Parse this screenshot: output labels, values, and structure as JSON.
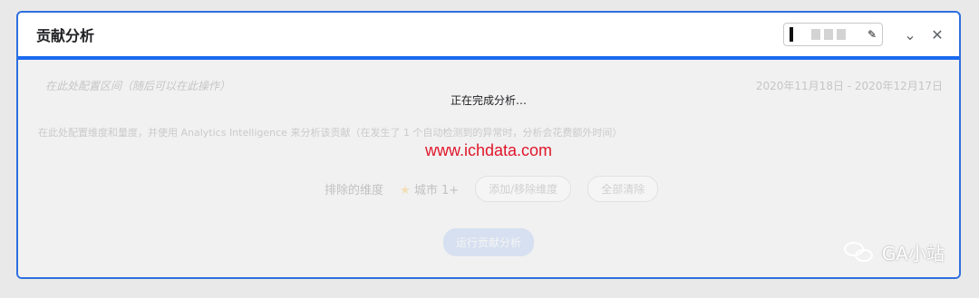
{
  "card": {
    "title": "贡献分析",
    "chip_edit_icon": "pencil-icon",
    "expand_icon": "chevron-down-icon",
    "close_icon": "close-icon"
  },
  "body": {
    "hint_text": "在此处配置区间（随后可以在此操作）",
    "date_range": "2020年11月18日 - 2020年12月17日",
    "description": "在此处配置维度和量度，并使用 Analytics Intelligence 来分析该贡献（在发生了 1 个自动检测到的异常时，分析会花费额外时间）",
    "excluded_dims_label": "排除的维度",
    "dim_name": "城市",
    "dim_count": "1+",
    "btn_add_dims": "添加/移除维度",
    "btn_clear_all": "全部清除",
    "run_button": "运行贡献分析",
    "loading_text": "正在完成分析…",
    "watermark": "www.ichdata.com"
  },
  "branding": {
    "icon": "wechat-icon",
    "text": "GA小站"
  }
}
